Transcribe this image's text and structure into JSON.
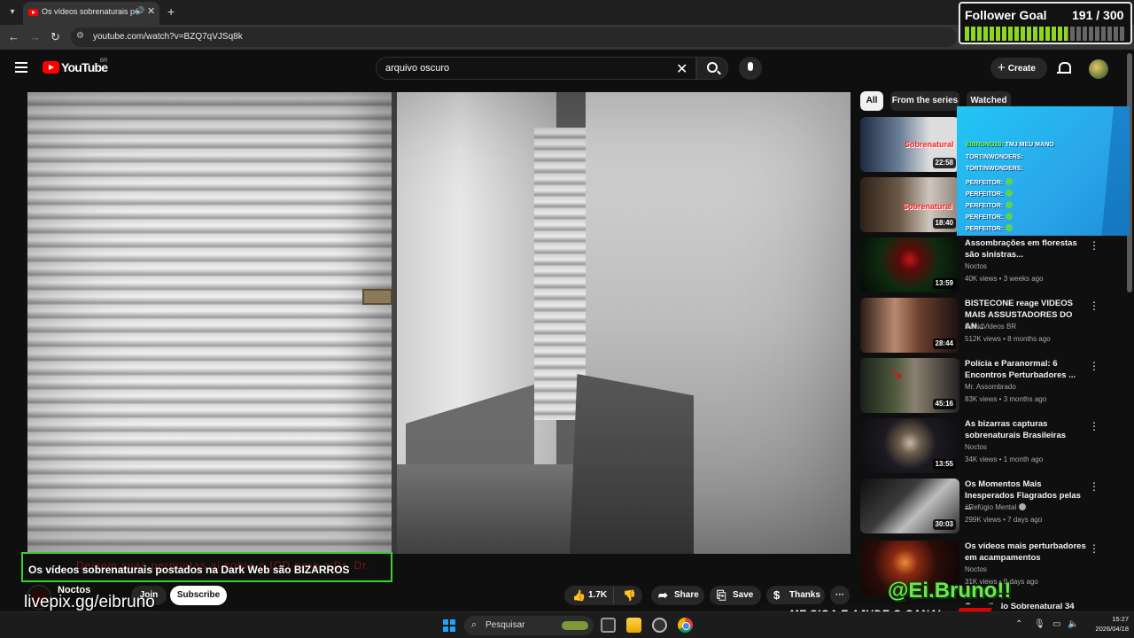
{
  "browser": {
    "tab_title": "Os vídeos sobrenaturais po",
    "tab_icon": "youtube-favicon",
    "url": "youtube.com/watch?v=BZQ7qVJSq8k"
  },
  "youtube": {
    "logo_text": "YouTube",
    "region": "BR",
    "search_query": "arquivo oscuro",
    "create_label": "Create"
  },
  "video": {
    "title": "Os vídeos sobrenaturais postados na Dark Web são BIZARROS",
    "ghost_text": "Deixem suas perguntas ai sobre o ICD para o Dr. Dr.",
    "channel": "Noctos",
    "join_label": "Join",
    "subscribe_label": "Subscribe",
    "likes": "1.7K",
    "share_label": "Share",
    "save_label": "Save",
    "thanks_label": "Thanks"
  },
  "filters": {
    "all": "All",
    "series": "From the series",
    "watched": "Watched"
  },
  "recommendations": [
    {
      "duration": "22:58",
      "title": "",
      "channel": "",
      "meta": "",
      "thumb_text": "Sobrenatural"
    },
    {
      "duration": "18:40",
      "title": "",
      "channel": "",
      "meta": "",
      "thumb_text": "Sobrenatural"
    },
    {
      "duration": "13:59",
      "title": "Assombrações em florestas são sinistras...",
      "channel": "Noctos",
      "meta": "40K views • 3 weeks ago"
    },
    {
      "duration": "28:44",
      "title": "BISTECONE reage VIDEOS MAIS ASSUSTADORES DO AN...",
      "channel": "DavidVideos BR",
      "meta": "512K views • 8 months ago"
    },
    {
      "duration": "45:16",
      "title": "Polícia e Paranormal: 6 Encontros Perturbadores ...",
      "channel": "Mr. Assombrado",
      "meta": "83K views • 3 months ago"
    },
    {
      "duration": "13:55",
      "title": "As bizarras capturas sobrenaturais Brasileiras",
      "channel": "Noctos",
      "meta": "34K views • 1 month ago"
    },
    {
      "duration": "30:03",
      "title": "Os Momentos Mais Inesperados Flagrados pelas ...",
      "channel": "#Refúgio Mental",
      "meta": "299K views • 7 days ago"
    },
    {
      "duration": "",
      "title": "Os vídeos mais perturbadores em acampamentos",
      "channel": "Noctos",
      "meta": "31K views • 9 days ago"
    }
  ],
  "peek_title": "Compilado Sobrenatural 34",
  "overlays": {
    "follower_goal_label": "Follower Goal",
    "follower_goal_count": "191 / 300",
    "follower_goal_progress": 0.637,
    "chat": [
      {
        "user": "",
        "text": ""
      },
      {
        "user": "",
        "text": ""
      },
      {
        "user": "EIBRUNOZ8:",
        "text": "TMJ MEU MANO"
      },
      {
        "user": "TORTINWONDERS:",
        "text": ""
      },
      {
        "user": "TORTINWONDERS:",
        "text": ""
      },
      {
        "user": "PERFEITOR:",
        "text": ""
      },
      {
        "user": "PERFEITOR:",
        "text": ""
      },
      {
        "user": "PERFEITOR:",
        "text": ""
      },
      {
        "user": "PERFEITOR:",
        "text": ""
      },
      {
        "user": "PERFEITOR:",
        "text": ""
      }
    ],
    "livepix": "livepix.gg/eibruno",
    "handle": "@Ei.Bruno!!",
    "banner": "ME SIGA E AJUDE O CANAL"
  },
  "taskbar": {
    "search_label": "Pesquisar",
    "time": "15:27",
    "date": "2026/04/18"
  },
  "colors": {
    "yt_red": "#ff0000",
    "goal_green": "#8ed61f",
    "chat_blue": "#21c7f5",
    "overlay_green": "#3ccf2c"
  }
}
